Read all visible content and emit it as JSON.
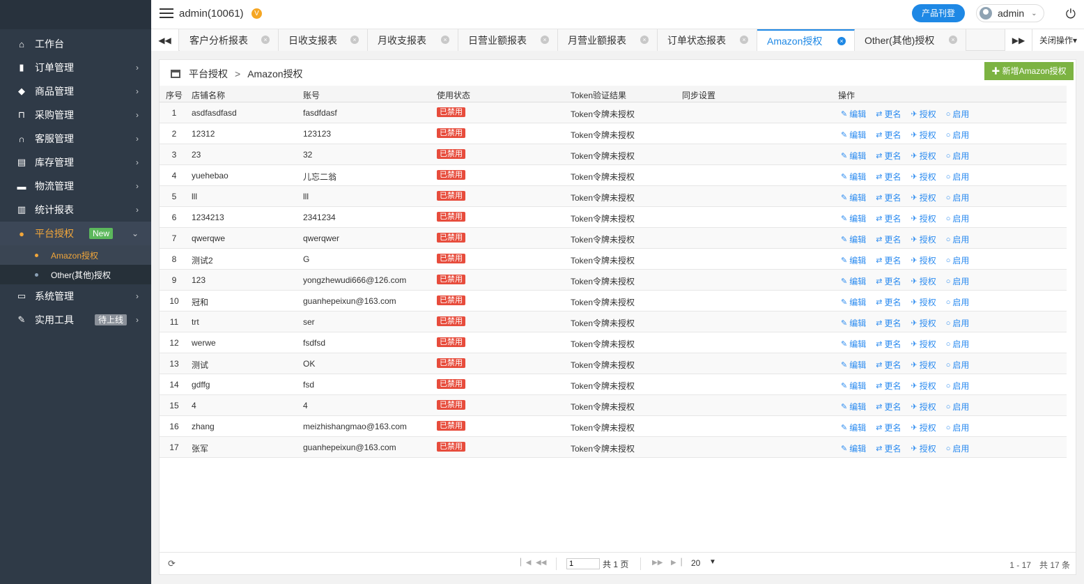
{
  "sidebar": {
    "items": [
      {
        "label": "工作台",
        "icon": "home-icon",
        "glyph": "⌂",
        "arrow": ""
      },
      {
        "label": "订单管理",
        "icon": "order-icon",
        "glyph": "▮",
        "arrow": "›"
      },
      {
        "label": "商品管理",
        "icon": "cube-icon",
        "glyph": "◆",
        "arrow": "›"
      },
      {
        "label": "采购管理",
        "icon": "cart-icon",
        "glyph": "⊓",
        "arrow": "›"
      },
      {
        "label": "客服管理",
        "icon": "headset-icon",
        "glyph": "∩",
        "arrow": "›"
      },
      {
        "label": "库存管理",
        "icon": "printer-icon",
        "glyph": "▤",
        "arrow": "›"
      },
      {
        "label": "物流管理",
        "icon": "truck-icon",
        "glyph": "▬",
        "arrow": "›"
      },
      {
        "label": "统计报表",
        "icon": "report-icon",
        "glyph": "▥",
        "arrow": "›"
      },
      {
        "label": "平台授权",
        "icon": "platform-icon",
        "glyph": "●",
        "arrow": "⌄",
        "badge": "New"
      },
      {
        "label": "系统管理",
        "icon": "monitor-icon",
        "glyph": "▭",
        "arrow": "›"
      },
      {
        "label": "实用工具",
        "icon": "wrench-icon",
        "glyph": "✎",
        "arrow": "›",
        "badge": "待上线"
      }
    ],
    "sub_items": [
      {
        "label": "Amazon授权"
      },
      {
        "label": "Other(其他)授权"
      }
    ]
  },
  "header": {
    "user_title": "admin(10061)",
    "v_badge": "V",
    "publish_button": "产品刊登",
    "username": "admin"
  },
  "tabs": {
    "items": [
      {
        "label": "客户分析报表"
      },
      {
        "label": "日收支报表"
      },
      {
        "label": "月收支报表"
      },
      {
        "label": "日营业额报表"
      },
      {
        "label": "月营业额报表"
      },
      {
        "label": "订单状态报表"
      },
      {
        "label": "Amazon授权"
      },
      {
        "label": "Other(其他)授权"
      }
    ],
    "close_ops": "关闭操作"
  },
  "content": {
    "breadcrumb_parent": "平台授权",
    "breadcrumb_current": "Amazon授权",
    "add_button": "新增Amazon授权",
    "columns": [
      "序号",
      "店铺名称",
      "账号",
      "使用状态",
      "Token验证结果",
      "同步设置",
      "操作"
    ],
    "rows": [
      {
        "no": "1",
        "shop": "asdfasdfasd",
        "account": "fasdfdasf",
        "status": "已禁用",
        "token": "Token令牌未授权"
      },
      {
        "no": "2",
        "shop": "12312",
        "account": "123123",
        "status": "已禁用",
        "token": "Token令牌未授权"
      },
      {
        "no": "3",
        "shop": "23",
        "account": "32",
        "status": "已禁用",
        "token": "Token令牌未授权"
      },
      {
        "no": "4",
        "shop": "yuehebao",
        "account": "儿忘二翁",
        "status": "已禁用",
        "token": "Token令牌未授权"
      },
      {
        "no": "5",
        "shop": "lll",
        "account": "lll",
        "status": "已禁用",
        "token": "Token令牌未授权"
      },
      {
        "no": "6",
        "shop": "1234213",
        "account": "2341234",
        "status": "已禁用",
        "token": "Token令牌未授权"
      },
      {
        "no": "7",
        "shop": "qwerqwe",
        "account": "qwerqwer",
        "status": "已禁用",
        "token": "Token令牌未授权"
      },
      {
        "no": "8",
        "shop": "测试2",
        "account": "G",
        "status": "已禁用",
        "token": "Token令牌未授权"
      },
      {
        "no": "9",
        "shop": "123",
        "account": "yongzhewudi666@126.com",
        "status": "已禁用",
        "token": "Token令牌未授权"
      },
      {
        "no": "10",
        "shop": "冠和",
        "account": "guanhepeixun@163.com",
        "status": "已禁用",
        "token": "Token令牌未授权"
      },
      {
        "no": "11",
        "shop": "trt",
        "account": "ser",
        "status": "已禁用",
        "token": "Token令牌未授权"
      },
      {
        "no": "12",
        "shop": "werwe",
        "account": "fsdfsd",
        "status": "已禁用",
        "token": "Token令牌未授权"
      },
      {
        "no": "13",
        "shop": "测试",
        "account": "OK",
        "status": "已禁用",
        "token": "Token令牌未授权"
      },
      {
        "no": "14",
        "shop": "gdffg",
        "account": "fsd",
        "status": "已禁用",
        "token": "Token令牌未授权"
      },
      {
        "no": "15",
        "shop": "4",
        "account": "4",
        "status": "已禁用",
        "token": "Token令牌未授权"
      },
      {
        "no": "16",
        "shop": "zhang",
        "account": "meizhishangmao@163.com",
        "status": "已禁用",
        "token": "Token令牌未授权"
      },
      {
        "no": "17",
        "shop": "张军",
        "account": "guanhepeixun@163.com",
        "status": "已禁用",
        "token": "Token令牌未授权"
      }
    ],
    "row_actions": [
      "编辑",
      "更名",
      "授权",
      "启用"
    ]
  },
  "pager": {
    "page_value": "1",
    "total_pages": "共 1 页",
    "page_size": "20",
    "range": "1 - 17　共 17 条"
  },
  "colors": {
    "sidebar_bg": "#2f3a47",
    "accent": "#1e88e5",
    "active_menu": "#f1a63a",
    "add_button": "#7cb342",
    "disabled_badge": "#e74c3c"
  }
}
